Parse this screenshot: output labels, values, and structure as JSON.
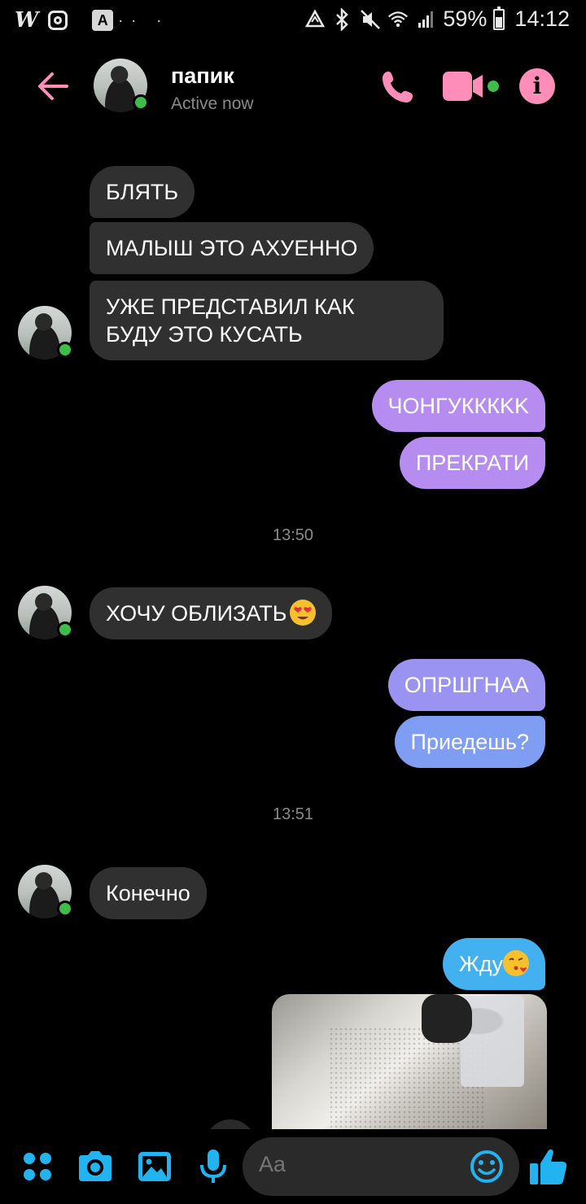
{
  "status_bar": {
    "left_icons": [
      "wattpad-w-icon",
      "instagram-icon",
      "app-icon",
      "more-dots"
    ],
    "app_letter": "A",
    "battery_percent": "59%",
    "battery_level": 0.59,
    "time": "14:12"
  },
  "header": {
    "contact_name": "папик",
    "contact_status": "Active now",
    "accent_color": "#ff8dba"
  },
  "messages": [
    {
      "dir": "in",
      "text": "БЛЯТЬ"
    },
    {
      "dir": "in",
      "text": "МАЛЫШ ЭТО АХУЕННО"
    },
    {
      "dir": "in",
      "text": "УЖЕ ПРЕДСТАВИЛ КАК\nБУДУ ЭТО КУСАТЬ"
    },
    {
      "dir": "out",
      "text": "ЧОНГУКККKK"
    },
    {
      "dir": "out",
      "text": "ПРЕКРАТИ"
    },
    {
      "dir": "in",
      "text": "ХОЧУ ОБЛИЗАТЬ",
      "emoji": "heart-eyes-emoji"
    },
    {
      "dir": "out",
      "text": "ОПРШГНАА"
    },
    {
      "dir": "out",
      "text": "Приедешь?"
    },
    {
      "dir": "in",
      "text": "Конечно"
    },
    {
      "dir": "out",
      "text": "Жду",
      "emoji": "kissing-heart-emoji"
    }
  ],
  "timestamps": [
    "13:50",
    "13:51"
  ],
  "composer": {
    "placeholder": "Aa"
  },
  "colors": {
    "incoming_bubble": "#303030",
    "outgoing_purple": "#b68cf0",
    "outgoing_blue": "#8f95f2",
    "outgoing_cyan": "#43b0ef",
    "toolbar_icons": "#22b4f0",
    "online": "#3fbd4a"
  }
}
